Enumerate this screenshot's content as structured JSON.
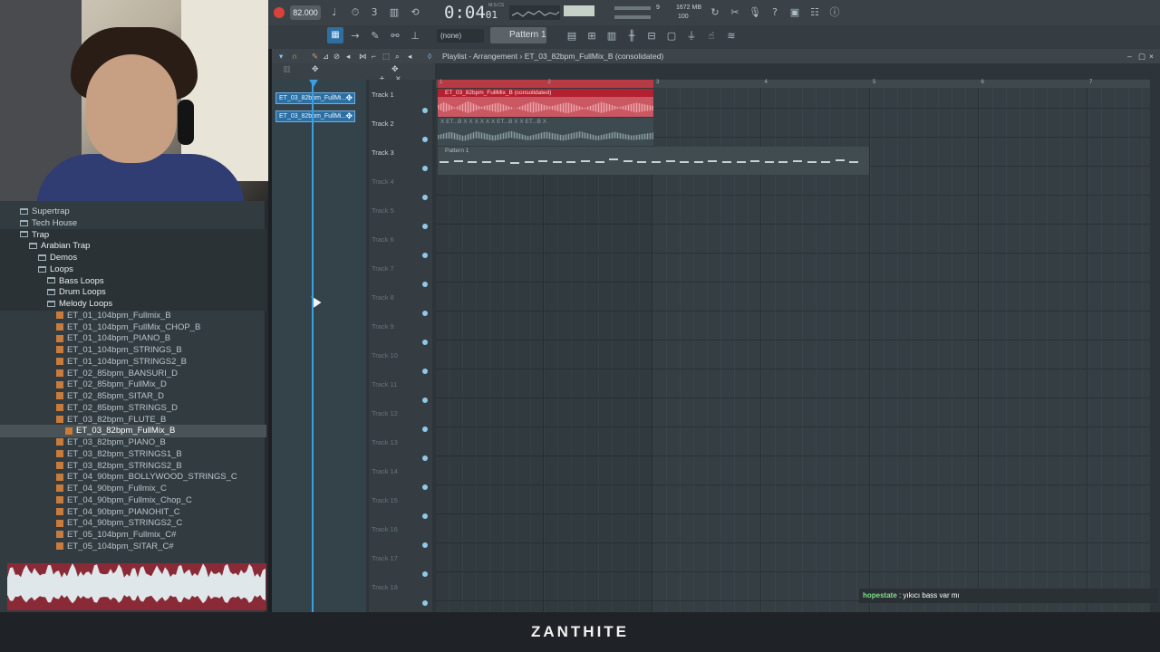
{
  "transport": {
    "tempo": "82.000",
    "time_main": "0:04",
    "time_sub": "01",
    "time_label": "M:S:CS",
    "cpu_value": "9",
    "ram_value": "1672 MB",
    "polyphony_value": "100",
    "pattern": "Pattern 1",
    "none_select": "(none)"
  },
  "browser": {
    "items": [
      {
        "label": "Supertrap",
        "type": "folder",
        "level": 0
      },
      {
        "label": "Tech House",
        "type": "folder",
        "level": 0
      },
      {
        "label": "Trap",
        "type": "folder",
        "level": 0
      },
      {
        "label": "Arabian Trap",
        "type": "folder",
        "level": 1
      },
      {
        "label": "Demos",
        "type": "folder",
        "level": 2
      },
      {
        "label": "Loops",
        "type": "folder",
        "level": 2
      },
      {
        "label": "Bass Loops",
        "type": "folder",
        "level": 3
      },
      {
        "label": "Drum Loops",
        "type": "folder",
        "level": 3
      },
      {
        "label": "Melody Loops",
        "type": "folder",
        "level": 3
      },
      {
        "label": "ET_01_104bpm_Fullmix_B",
        "type": "file",
        "level": 4
      },
      {
        "label": "ET_01_104bpm_FullMix_CHOP_B",
        "type": "file",
        "level": 4
      },
      {
        "label": "ET_01_104bpm_PIANO_B",
        "type": "file",
        "level": 4
      },
      {
        "label": "ET_01_104bpm_STRINGS_B",
        "type": "file",
        "level": 4
      },
      {
        "label": "ET_01_104bpm_STRINGS2_B",
        "type": "file",
        "level": 4
      },
      {
        "label": "ET_02_85bpm_BANSURI_D",
        "type": "file",
        "level": 4
      },
      {
        "label": "ET_02_85bpm_FullMix_D",
        "type": "file",
        "level": 4
      },
      {
        "label": "ET_02_85bpm_SITAR_D",
        "type": "file",
        "level": 4
      },
      {
        "label": "ET_02_85bpm_STRINGS_D",
        "type": "file",
        "level": 4
      },
      {
        "label": "ET_03_82bpm_FLUTE_B",
        "type": "file",
        "level": 4
      },
      {
        "label": "ET_03_82bpm_FullMix_B",
        "type": "file",
        "level": 5
      },
      {
        "label": "ET_03_82bpm_PIANO_B",
        "type": "file",
        "level": 4
      },
      {
        "label": "ET_03_82bpm_STRINGS1_B",
        "type": "file",
        "level": 4
      },
      {
        "label": "ET_03_82bpm_STRINGS2_B",
        "type": "file",
        "level": 4
      },
      {
        "label": "ET_04_90bpm_BOLLYWOOD_STRINGS_C",
        "type": "file",
        "level": 4
      },
      {
        "label": "ET_04_90bpm_Fullmix_C",
        "type": "file",
        "level": 4
      },
      {
        "label": "ET_04_90bpm_Fullmix_Chop_C",
        "type": "file",
        "level": 4
      },
      {
        "label": "ET_04_90bpm_PIANOHIT_C",
        "type": "file",
        "level": 4
      },
      {
        "label": "ET_04_90bpm_STRINGS2_C",
        "type": "file",
        "level": 4
      },
      {
        "label": "ET_05_104bpm_Fullmix_C#",
        "type": "file",
        "level": 4
      },
      {
        "label": "ET_05_104bpm_SITAR_C#",
        "type": "file",
        "level": 4
      }
    ]
  },
  "playlist": {
    "title": "Playlist - Arrangement › ET_03_82bpm_FullMix_B (consolidated)",
    "picker": [
      {
        "label": "ET_03_82bpm_FullMi..."
      },
      {
        "label": "ET_03_82bpm_FullMi..."
      }
    ],
    "tracks": [
      {
        "label": "Track 1"
      },
      {
        "label": "Track 2"
      },
      {
        "label": "Track 3"
      },
      {
        "label": "Track 4"
      },
      {
        "label": "Track 5"
      },
      {
        "label": "Track 6"
      },
      {
        "label": "Track 7"
      },
      {
        "label": "Track 8"
      },
      {
        "label": "Track 9"
      },
      {
        "label": "Track 10"
      },
      {
        "label": "Track 11"
      },
      {
        "label": "Track 12"
      },
      {
        "label": "Track 13"
      },
      {
        "label": "Track 14"
      },
      {
        "label": "Track 15"
      },
      {
        "label": "Track 16"
      },
      {
        "label": "Track 17"
      },
      {
        "label": "Track 18"
      }
    ],
    "ruler": [
      "1",
      "2",
      "3",
      "4",
      "5",
      "6",
      "7"
    ],
    "clip1_label": "ET_03_82bpm_FullMix_B (consolidated)",
    "clip2_label": "X ET...B X   X X X X   X ET...B X   X ET...B X",
    "clip3_label": "Pattern 1"
  },
  "chat": {
    "user": "hopestate",
    "message": ": yıkıcı bass var mı"
  },
  "footer": {
    "text": "ZANTHITE"
  },
  "colors": {
    "accent": "#3aa0df",
    "clip_red": "#c95862",
    "record": "#d8423a"
  }
}
